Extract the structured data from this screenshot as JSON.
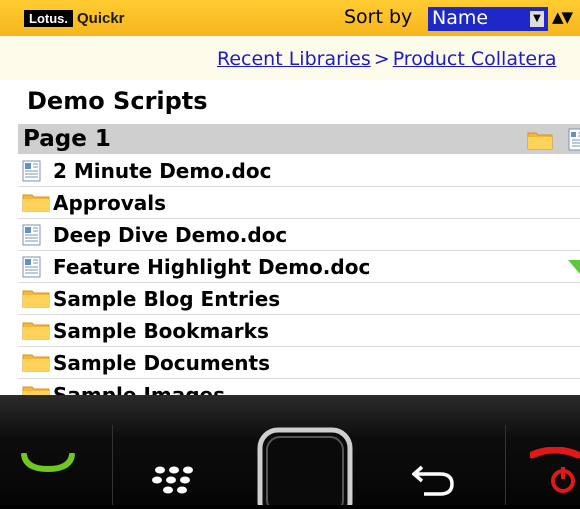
{
  "app": {
    "brand_lotus": "Lotus.",
    "brand_quickr": "Quickr"
  },
  "sort": {
    "label": "Sort by",
    "value": "Name"
  },
  "breadcrumb": {
    "items": [
      "Recent Libraries",
      "Product Collatera"
    ],
    "separator": ">"
  },
  "page_title": "Demo Scripts",
  "section": {
    "label": "Page 1"
  },
  "list": [
    {
      "label": "2 Minute Demo.doc",
      "icon": "document-icon"
    },
    {
      "label": "Approvals",
      "icon": "folder-icon"
    },
    {
      "label": "Deep Dive Demo.doc",
      "icon": "document-icon"
    },
    {
      "label": "Feature Highlight Demo.doc",
      "icon": "document-icon"
    },
    {
      "label": "Sample Blog Entries",
      "icon": "folder-icon"
    },
    {
      "label": "Sample Bookmarks",
      "icon": "folder-icon"
    },
    {
      "label": "Sample Documents",
      "icon": "folder-icon"
    },
    {
      "label": "Sample Images",
      "icon": "folder-icon"
    }
  ],
  "colors": {
    "header_yellow": "#f7b51c",
    "select_blue": "#1e28c8",
    "link_blue": "#1c1cc8",
    "call_green": "#6ec81e",
    "end_red": "#e01818"
  },
  "keys": [
    "call-key-icon",
    "blackberry-menu-key-icon",
    "trackpad-icon",
    "back-key-icon",
    "end-call-key-icon"
  ]
}
